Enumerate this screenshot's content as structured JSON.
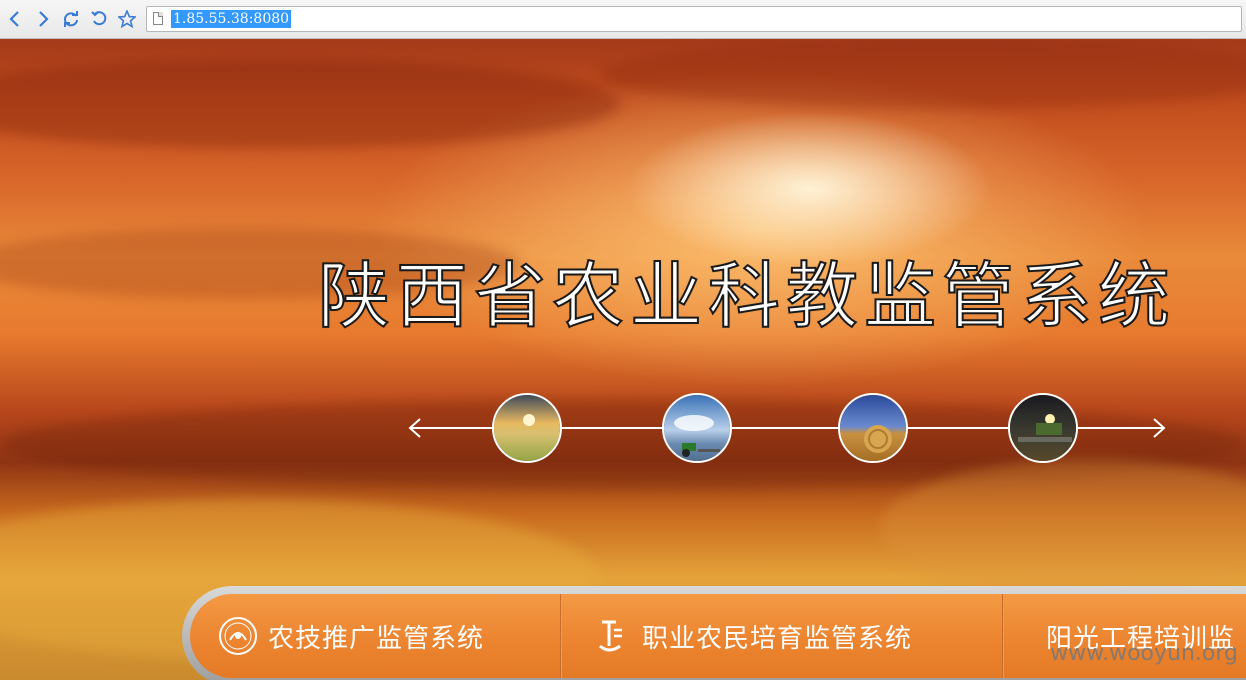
{
  "browser": {
    "back_icon": "chevron-left-icon",
    "forward_icon": "chevron-right-icon",
    "reload_icon": "reload-icon",
    "undo_icon": "undo-icon",
    "star_icon": "star-icon",
    "url": "1.85.55.38:8080"
  },
  "hero": {
    "title": "陕西省农业科教监管系统"
  },
  "nav": {
    "items": [
      {
        "label": "农技推广监管系统",
        "icon": "emblem-icon"
      },
      {
        "label": "职业农民培育监管系统",
        "icon": "sprout-logo-icon"
      },
      {
        "label": "阳光工程培训监",
        "icon": ""
      }
    ]
  },
  "watermark": "www.wooyun.org",
  "colors": {
    "accent": "#ec8430",
    "selection": "#3399ff"
  }
}
